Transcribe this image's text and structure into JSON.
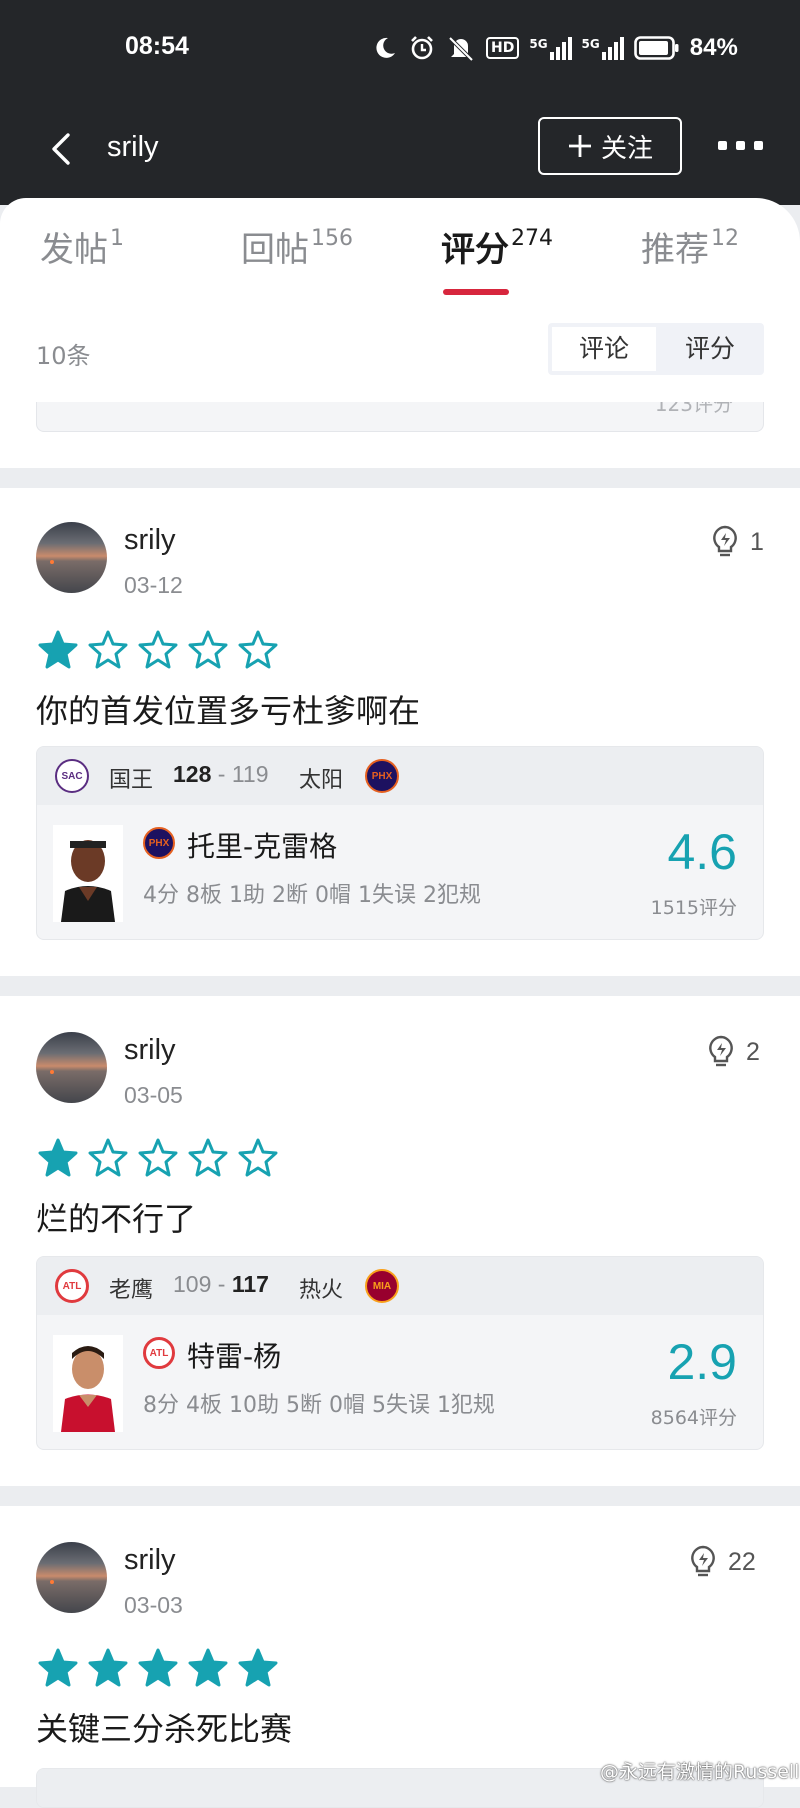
{
  "status_bar": {
    "time": "08:54",
    "battery": "84%",
    "network_badge": "HD",
    "signal1": "5G",
    "signal2": "5G"
  },
  "header": {
    "username": "srily",
    "follow_label": "关注"
  },
  "tabs": [
    {
      "label": "发帖",
      "count": "1"
    },
    {
      "label": "回帖",
      "count": "156"
    },
    {
      "label": "评分",
      "count": "274"
    },
    {
      "label": "推荐",
      "count": "12"
    }
  ],
  "list": {
    "count_label": "10条",
    "segment": [
      "评论",
      "评分"
    ],
    "remnant_text": "123评分"
  },
  "posts": [
    {
      "user": "srily",
      "date": "03-12",
      "likes": "1",
      "stars": 1,
      "text": "你的首发位置多亏杜爹啊在",
      "game": {
        "team1": "国王",
        "team1_abbr": "SAC",
        "score1": "128",
        "score2": "119",
        "team2": "太阳",
        "team2_abbr": "PHX",
        "winner": 1
      },
      "player": {
        "name": "托里-克雷格",
        "team_abbr": "PHX",
        "stats": "4分 8板 1助 2断 0帽 1失误 2犯规",
        "rating": "4.6",
        "rating_count": "1515评分"
      }
    },
    {
      "user": "srily",
      "date": "03-05",
      "likes": "2",
      "stars": 1,
      "text": "烂的不行了",
      "game": {
        "team1": "老鹰",
        "team1_abbr": "ATL",
        "score1": "109",
        "score2": "117",
        "team2": "热火",
        "team2_abbr": "MIA",
        "winner": 2
      },
      "player": {
        "name": "特雷-杨",
        "team_abbr": "ATL",
        "stats": "8分 4板 10助 5断 0帽 5失误 1犯规",
        "rating": "2.9",
        "rating_count": "8564评分"
      }
    },
    {
      "user": "srily",
      "date": "03-03",
      "likes": "22",
      "stars": 5,
      "text": "关键三分杀死比赛"
    }
  ],
  "watermark": "@永远有激情的Russell",
  "colors": {
    "accent": "#17a2b1",
    "tab_indicator": "#d7263d",
    "header_bg": "#242629"
  }
}
